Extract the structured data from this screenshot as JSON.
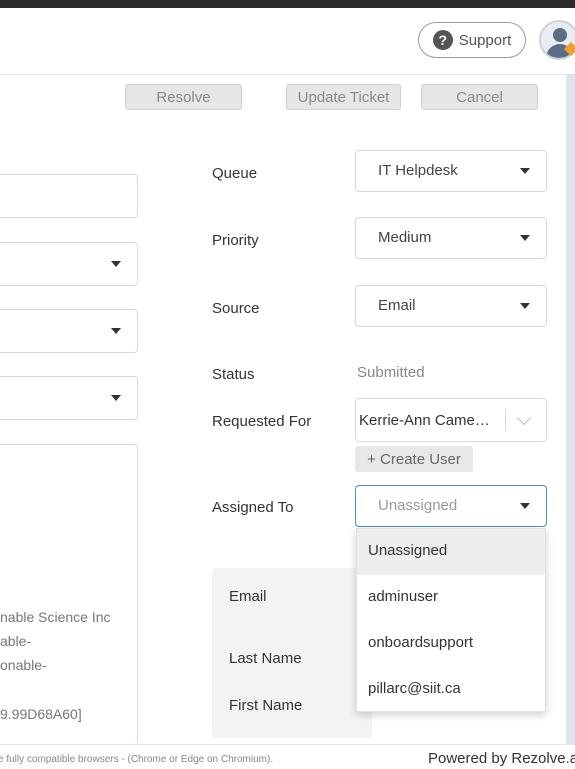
{
  "header": {
    "support_label": "Support",
    "support_icon": "question-circle-icon",
    "avatar_icon": "user-avatar-icon"
  },
  "actions": {
    "resolve": "Resolve",
    "update_ticket": "Update Ticket",
    "cancel": "Cancel"
  },
  "left_panel": {
    "org_line1": "nable Science Inc",
    "org_line2": "able-",
    "org_line3": "onable-",
    "id_line": "9.99D68A60]"
  },
  "form": {
    "queue_label": "Queue",
    "queue_value": "IT Helpdesk",
    "priority_label": "Priority",
    "priority_value": "Medium",
    "source_label": "Source",
    "source_value": "Email",
    "status_label": "Status",
    "status_value": "Submitted",
    "requested_for_label": "Requested For",
    "requested_for_value": "Kerrie-Ann Came…",
    "create_user_label": "+ Create User",
    "assigned_to_label": "Assigned To",
    "assigned_to_value": "Unassigned"
  },
  "assigned_dropdown": {
    "options": [
      "Unassigned",
      "adminuser",
      "onboardsupport",
      "pillarc@siit.ca"
    ],
    "highlighted_index": 0
  },
  "info": {
    "email_label": "Email",
    "last_name_label": "Last Name",
    "first_name_label": "First Name"
  },
  "footer": {
    "compat_note": "e fully compatible browsers - (Chrome or Edge on Chromium).",
    "powered_by": "Powered by Rezolve.a"
  },
  "colors": {
    "focus_border": "#4a8fcf",
    "top_strip": "#2b2b2b"
  }
}
